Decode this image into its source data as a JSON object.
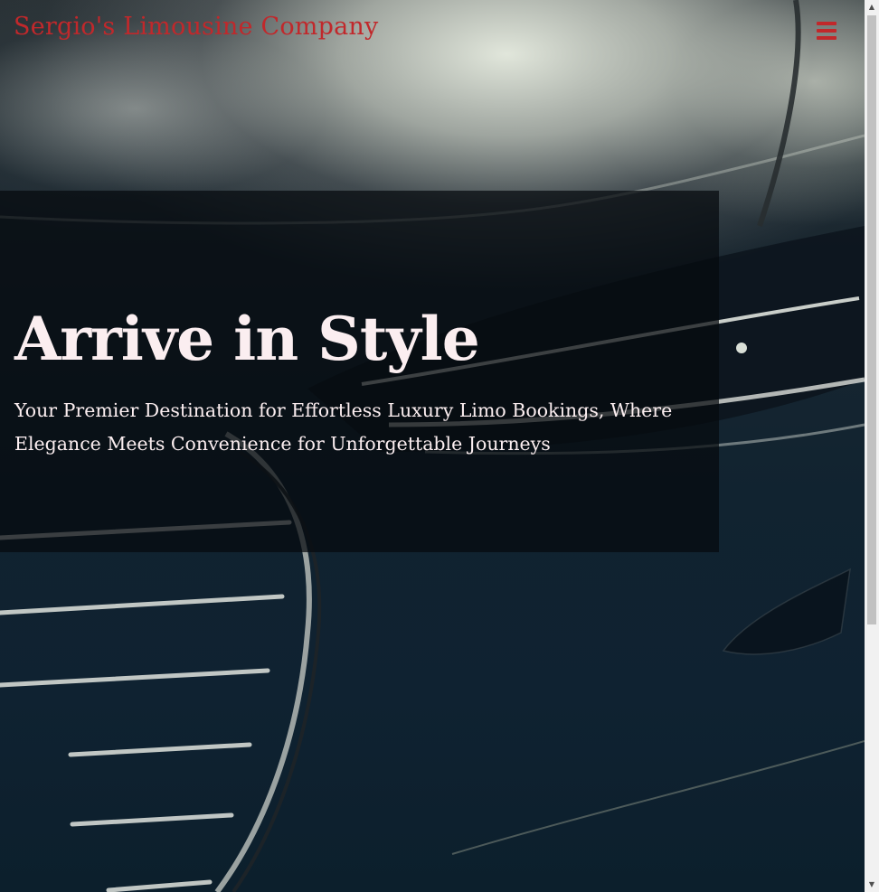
{
  "navbar": {
    "brand": "Sergio's Limousine Company",
    "menu_icon": "hamburger-menu-icon",
    "accent_color": "#c1282b"
  },
  "hero": {
    "title": "Arrive in Style",
    "subtitle": "Your Premier Destination for Effortless Luxury Limo Bookings, Where Elegance Meets Convenience for Unforgettable Journeys",
    "text_color": "#fbeef0",
    "background_image": "dark-luxury-car-front-headlight-grille"
  },
  "scrollbar": {
    "up_icon": "scroll-up-arrow-icon",
    "down_icon": "scroll-down-arrow-icon"
  }
}
